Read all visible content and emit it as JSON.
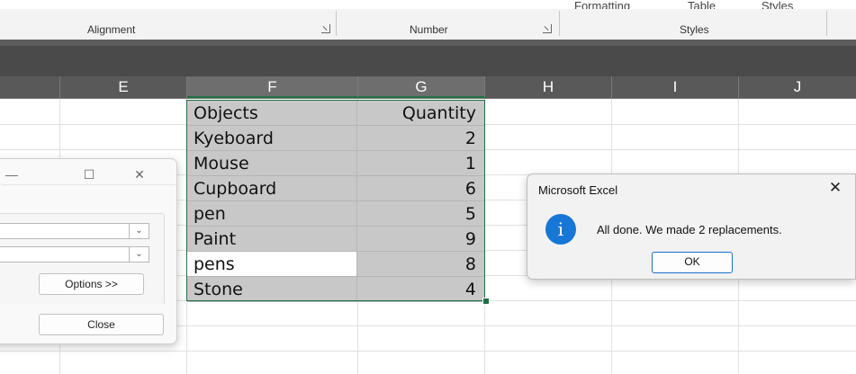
{
  "ribbon": {
    "top_cut_labels": [
      "Formatting",
      "Table",
      "Styles"
    ],
    "groups": [
      {
        "label": "Alignment"
      },
      {
        "label": "Number"
      },
      {
        "label": "Styles"
      }
    ]
  },
  "columns": [
    "E",
    "F",
    "G",
    "H",
    "I",
    "J"
  ],
  "table": {
    "headers": [
      "Objects",
      "Quantity"
    ],
    "rows": [
      {
        "object": "Kyeboard",
        "qty": "2"
      },
      {
        "object": "Mouse",
        "qty": "1"
      },
      {
        "object": "Cupboard",
        "qty": "6"
      },
      {
        "object": "pen",
        "qty": "5"
      },
      {
        "object": "Paint",
        "qty": "9"
      },
      {
        "object": "pens",
        "qty": "8"
      },
      {
        "object": "Stone",
        "qty": "4"
      }
    ]
  },
  "find_replace": {
    "minimize_glyph": "—",
    "maximize_glyph": "☐",
    "close_glyph": "✕",
    "options_label": "Options >>",
    "close_label": "Close"
  },
  "message_box": {
    "title": "Microsoft Excel",
    "close_glyph": "✕",
    "icon_glyph": "i",
    "message": "All done. We made 2 replacements.",
    "ok_label": "OK"
  }
}
